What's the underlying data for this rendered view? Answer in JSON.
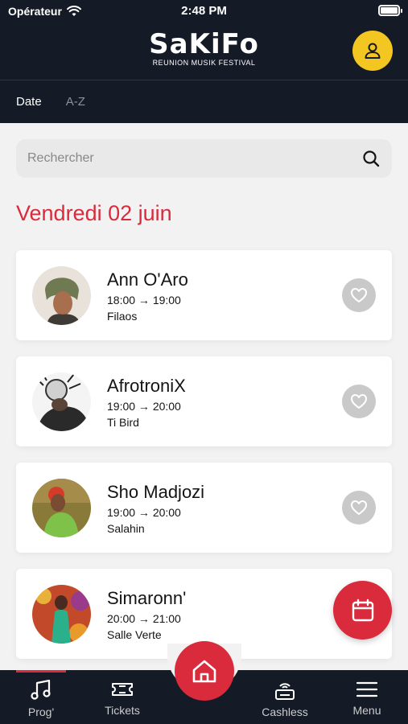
{
  "status_bar": {
    "carrier": "Opérateur",
    "time": "2:48 PM"
  },
  "header": {
    "logo_text": "SaKiFo",
    "logo_subtitle": "REUNION MUSIK FESTIVAL",
    "profile_icon": "user-icon"
  },
  "tabs": [
    {
      "label": "Date",
      "active": true
    },
    {
      "label": "A-Z",
      "active": false
    }
  ],
  "search": {
    "placeholder": "Rechercher",
    "icon": "search-icon"
  },
  "day_heading": "Vendredi 02 juin",
  "artists": [
    {
      "name": "Ann O'Aro",
      "time": "18:00 → 19:00",
      "venue": "Filaos",
      "favorite": false
    },
    {
      "name": "AfrotroniX",
      "time": "19:00 → 20:00",
      "venue": "Ti Bird",
      "favorite": false
    },
    {
      "name": "Sho Madjozi",
      "time": "19:00 → 20:00",
      "venue": "Salahin",
      "favorite": false
    },
    {
      "name": "Simaronn'",
      "time": "20:00 → 21:00",
      "venue": "Salle Verte",
      "favorite": false
    }
  ],
  "bottom_nav": [
    {
      "label": "Prog'",
      "icon": "music-note-icon",
      "active": true
    },
    {
      "label": "Tickets",
      "icon": "ticket-icon",
      "active": false
    },
    {
      "label": "",
      "icon": "home-icon",
      "active": false
    },
    {
      "label": "Cashless",
      "icon": "cashless-terminal-icon",
      "active": false
    },
    {
      "label": "Menu",
      "icon": "menu-icon",
      "active": false
    }
  ],
  "colors": {
    "brand_red": "#d92b3c",
    "header_bg": "#141a26",
    "profile_yellow": "#f3c622"
  }
}
